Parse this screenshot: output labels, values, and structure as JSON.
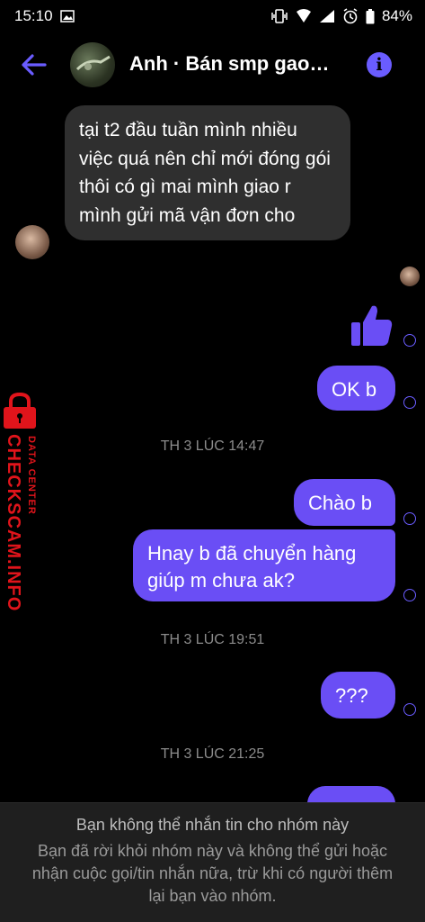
{
  "status_bar": {
    "time": "15:10",
    "battery": "84%"
  },
  "header": {
    "title": "Anh · Bán smp gao…"
  },
  "messages": {
    "incoming_1": "tại t2 đầu tuần mình nhiều việc quá nên chỉ mới đóng gói thôi có gì mai mình giao r mình gửi mã vận đơn cho",
    "out_ok": "OK b",
    "out_chao": "Chào b",
    "out_hnay": "Hnay b đã chuyển hàng giúp m chưa ak?",
    "out_q": "???"
  },
  "timestamps": {
    "t1": "TH 3 LÚC 14:47",
    "t2": "TH 3 LÚC 19:51",
    "t3": "TH 3 LÚC 21:25"
  },
  "watermark": {
    "line1": "CHECKSCAM.INFO",
    "line2": "DATA CENTER"
  },
  "footer": {
    "title": "Bạn không thể nhắn tin cho nhóm này",
    "body": "Bạn đã rời khỏi nhóm này và không thể gửi hoặc nhận cuộc gọi/tin nhắn nữa, trừ khi có người thêm lại bạn vào nhóm."
  },
  "colors": {
    "accent": "#6a4ef5",
    "incoming_bg": "#2f2f2f",
    "watermark": "#e0141b"
  }
}
